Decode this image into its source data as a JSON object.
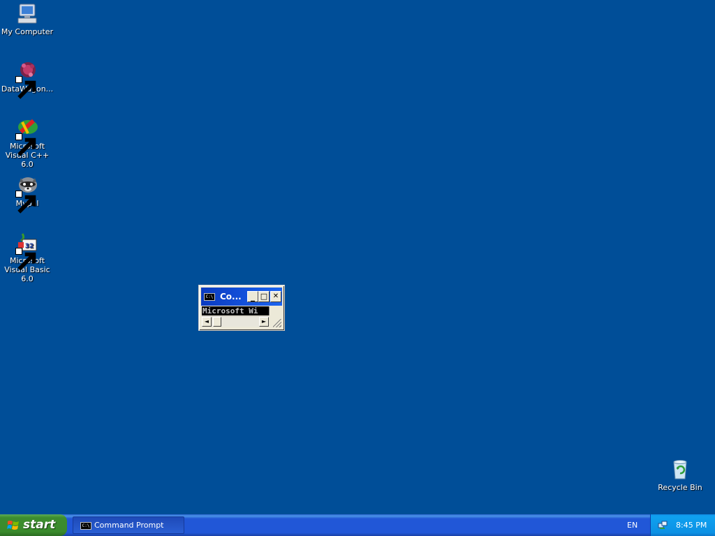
{
  "desktop": {
    "background_color": "#004e98",
    "icons": [
      {
        "label": "My Computer",
        "icon": "my-computer-icon"
      },
      {
        "label": "DataWagon...",
        "icon": "datawagon-icon"
      },
      {
        "label": "Microsoft Visual C++ 6.0",
        "icon": "visual-cpp-icon"
      },
      {
        "label": "Mypal",
        "icon": "mypal-raccoon-icon"
      },
      {
        "label": "Microsoft Visual Basic 6.0",
        "icon": "visual-basic-icon"
      },
      {
        "label": "Recycle Bin",
        "icon": "recycle-bin-icon"
      }
    ]
  },
  "cmd_window": {
    "title": "Co...",
    "icon": "cmd-icon",
    "icon_text": "C:\\",
    "body_text": "Microsoft Wi",
    "minimize_glyph": "_",
    "maximize_glyph": "□",
    "close_glyph": "✕",
    "scroll_left": "◄",
    "scroll_right": "►"
  },
  "taskbar": {
    "start_label": "start",
    "task_items": [
      {
        "label": "Command Prompt",
        "icon": "cmd-icon",
        "icon_text": "C:\\"
      }
    ],
    "language": "EN",
    "clock": "8:45 PM",
    "tray_icon": "network-icon"
  }
}
